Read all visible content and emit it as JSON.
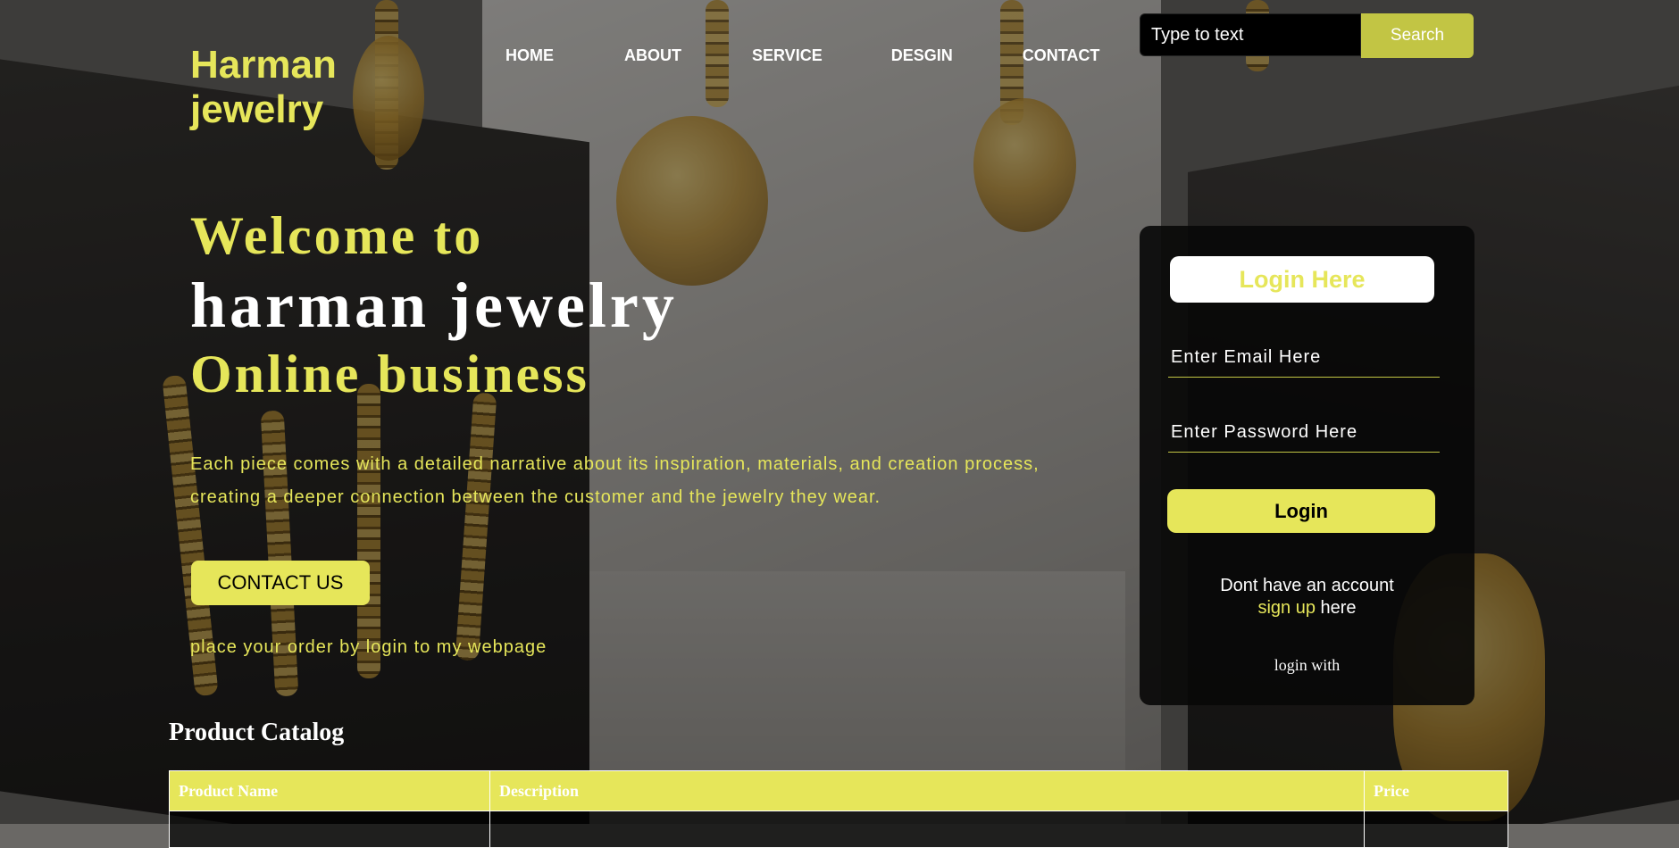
{
  "brand": {
    "line1": "Harman",
    "line2": "jewelry"
  },
  "nav": [
    "HOME",
    "ABOUT",
    "SERVICE",
    "DESGIN",
    "CONTACT"
  ],
  "search": {
    "placeholder": "Type to text",
    "button": "Search"
  },
  "hero": {
    "line1": "Welcome to",
    "line2": "harman jewelry",
    "line3": "Online business",
    "description": "Each piece comes with a detailed narrative about its inspiration, materials, and creation process, creating a deeper connection between the customer and the jewelry they wear.",
    "contact_button": "CONTACT US",
    "order_note": "place your order by login to my webpage"
  },
  "login": {
    "title": "Login Here",
    "email_placeholder": "Enter Email Here",
    "password_placeholder": "Enter Password Here",
    "submit": "Login",
    "no_account": "Dont have an account",
    "signup_link": "sign up",
    "signup_suffix": " here",
    "login_with": "login with"
  },
  "catalog": {
    "title": "Product Catalog",
    "headers": [
      "Product Name",
      "Description",
      "Price"
    ]
  },
  "colors": {
    "accent": "#e6e65a",
    "search_button": "#c2c544"
  }
}
